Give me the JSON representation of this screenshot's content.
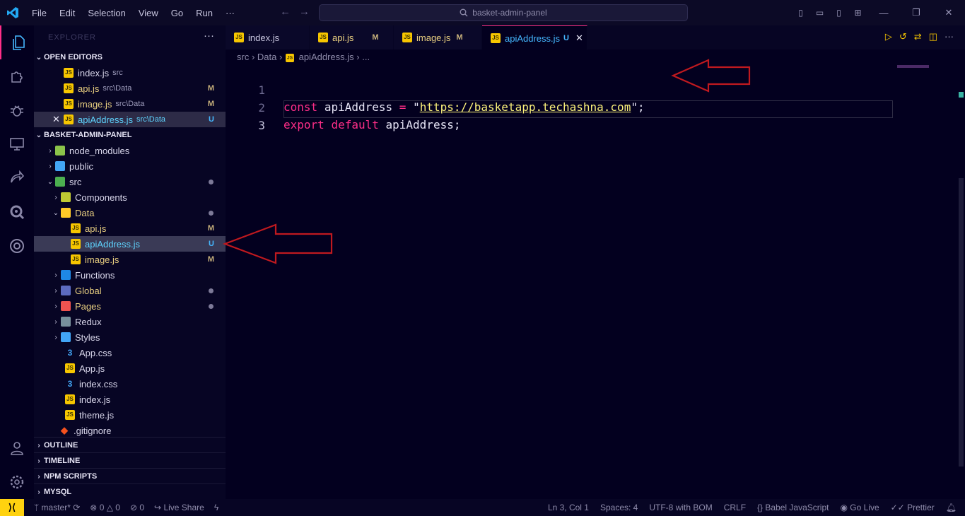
{
  "menu": [
    "File",
    "Edit",
    "Selection",
    "View",
    "Go",
    "Run",
    "···"
  ],
  "search_text": "basket-admin-panel",
  "sidebar": {
    "title": "EXPLORER",
    "open_editors_label": "OPEN EDITORS",
    "open_editors": [
      {
        "name": "index.js",
        "desc": "src",
        "badge": ""
      },
      {
        "name": "api.js",
        "desc": "src\\Data",
        "badge": "M"
      },
      {
        "name": "image.js",
        "desc": "src\\Data",
        "badge": "M"
      },
      {
        "name": "apiAddress.js",
        "desc": "src\\Data",
        "badge": "U"
      }
    ],
    "project_label": "BASKET-ADMIN-PANEL",
    "tree": [
      {
        "name": "node_modules",
        "type": "folder"
      },
      {
        "name": "public",
        "type": "folder"
      },
      {
        "name": "src",
        "type": "folder"
      },
      {
        "name": "Components",
        "type": "folder"
      },
      {
        "name": "Data",
        "type": "folder"
      },
      {
        "name": "api.js",
        "type": "js",
        "badge": "M"
      },
      {
        "name": "apiAddress.js",
        "type": "js",
        "badge": "U"
      },
      {
        "name": "image.js",
        "type": "js",
        "badge": "M"
      },
      {
        "name": "Functions",
        "type": "folder"
      },
      {
        "name": "Global",
        "type": "folder"
      },
      {
        "name": "Pages",
        "type": "folder"
      },
      {
        "name": "Redux",
        "type": "folder"
      },
      {
        "name": "Styles",
        "type": "folder"
      },
      {
        "name": "App.css",
        "type": "css"
      },
      {
        "name": "App.js",
        "type": "js"
      },
      {
        "name": "index.css",
        "type": "css"
      },
      {
        "name": "index.js",
        "type": "js"
      },
      {
        "name": "theme.js",
        "type": "js"
      },
      {
        "name": ".gitignore",
        "type": "git"
      }
    ],
    "sections": [
      "OUTLINE",
      "TIMELINE",
      "NPM SCRIPTS",
      "MYSQL"
    ]
  },
  "tabs": [
    {
      "name": "index.js",
      "badge": ""
    },
    {
      "name": "api.js",
      "badge": "M"
    },
    {
      "name": "image.js",
      "badge": "M"
    },
    {
      "name": "apiAddress.js",
      "badge": "U"
    }
  ],
  "breadcrumb": [
    "src",
    "Data",
    "apiAddress.js",
    "..."
  ],
  "code": {
    "line_numbers": [
      "1",
      "2",
      "3"
    ],
    "l1_kw": "const",
    "l1_id": "apiAddress",
    "l1_eq": "=",
    "l1_q1": "\"",
    "l1_url": "https://basketapp.techashna.com",
    "l1_q2": "\"",
    "l1_semi": ";",
    "l2_kw1": "export",
    "l2_kw2": "default",
    "l2_id": "apiAddress;"
  },
  "status": {
    "branch": "master*",
    "errors": "0",
    "warnings": "0",
    "ports": "0",
    "live_share": "Live Share",
    "position": "Ln 3, Col 1",
    "spaces": "Spaces: 4",
    "encoding": "UTF-8 with BOM",
    "eol": "CRLF",
    "language": "Babel JavaScript",
    "go_live": "Go Live",
    "prettier": "Prettier"
  },
  "colors": {
    "accent": "#ff2e88",
    "js": "#f7c600",
    "arrow": "#c0191f",
    "background": "#03001f"
  }
}
